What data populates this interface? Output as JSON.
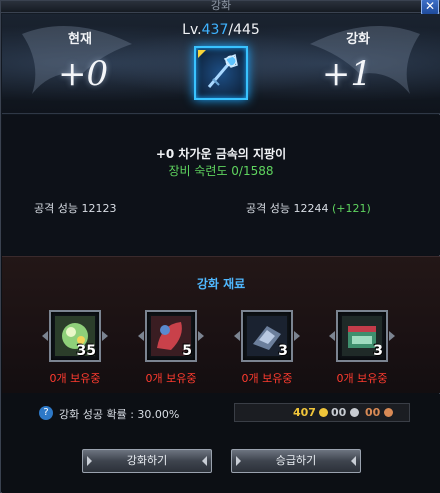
{
  "window": {
    "title": "강화",
    "close_label": "✕"
  },
  "header": {
    "current_label": "현재",
    "enhance_label": "강화",
    "current_plus": "+0",
    "next_plus": "+1",
    "level_prefix": "Lv.",
    "level_current": "437",
    "level_separator": "/",
    "level_max": "445"
  },
  "item": {
    "name": "+0 차가운 금속의 지팡이",
    "proficiency": "장비 숙련도 0/1588"
  },
  "stats": {
    "current_label": "공격 성능  12123",
    "next_label": "공격 성능  12244 ",
    "bonus": "(+121)"
  },
  "materials": {
    "title": "강화 재료",
    "items": [
      {
        "count": "35",
        "owned": "0개 보유중",
        "icon": "green-gem-icon"
      },
      {
        "count": "5",
        "owned": "0개 보유중",
        "icon": "red-scroll-icon"
      },
      {
        "count": "3",
        "owned": "0개 보유중",
        "icon": "blue-crystal-icon"
      },
      {
        "count": "3",
        "owned": "0개 보유중",
        "icon": "green-box-icon"
      }
    ]
  },
  "footer": {
    "help_label": "?",
    "success_rate": "강화 성공 확률 : 30.00%",
    "gold": "407",
    "silver": "00",
    "copper": "00",
    "enhance_button": "강화하기",
    "promote_button": "승급하기"
  },
  "colors": {
    "accent": "#3fb3ff",
    "bonus": "#5fd45f",
    "owned_warning": "#ff3b2f",
    "gold": "#f0c53a",
    "silver": "#c8ccd2",
    "copper": "#d98a55"
  }
}
